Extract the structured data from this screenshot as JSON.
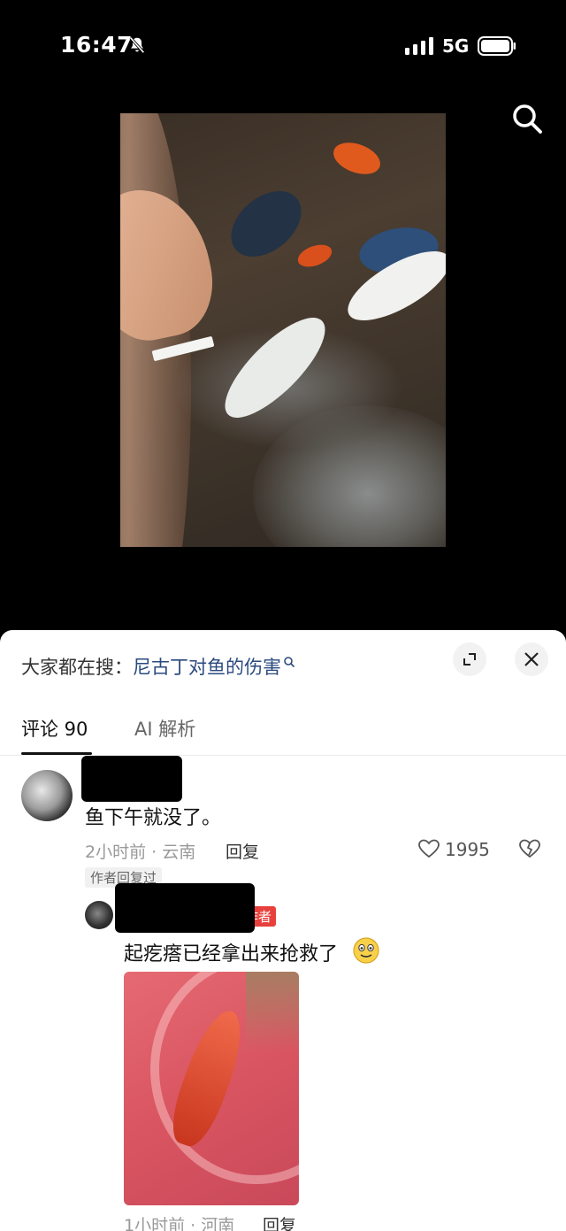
{
  "status_bar": {
    "time": "16:47",
    "network": "5G",
    "icons": [
      "bell-muted-icon",
      "signal-icon",
      "battery-icon"
    ]
  },
  "video": {
    "icon": "search-icon"
  },
  "sheet": {
    "trending_prefix": "大家都在搜：",
    "trending_keyword": "尼古丁对鱼的伤害",
    "tabs": [
      {
        "label": "评论 90",
        "active": true
      },
      {
        "label": "AI 解析",
        "active": false
      }
    ]
  },
  "comments": [
    {
      "text": "鱼下午就没了。",
      "time_location": "2小时前 · 云南",
      "reply_label": "回复",
      "likes": "1995",
      "author_replied_badge": "作者回复过",
      "replies": [
        {
          "author_tag": "作者",
          "text": "起疙瘩已经拿出来抢救了",
          "emoji": "smiling-face-icon",
          "time_location": "1小时前 · 河南",
          "reply_label": "回复"
        }
      ]
    }
  ],
  "colors": {
    "keyword": "#2a4a7f",
    "author_tag_bg": "#e8413d",
    "background_top": "#000000"
  }
}
